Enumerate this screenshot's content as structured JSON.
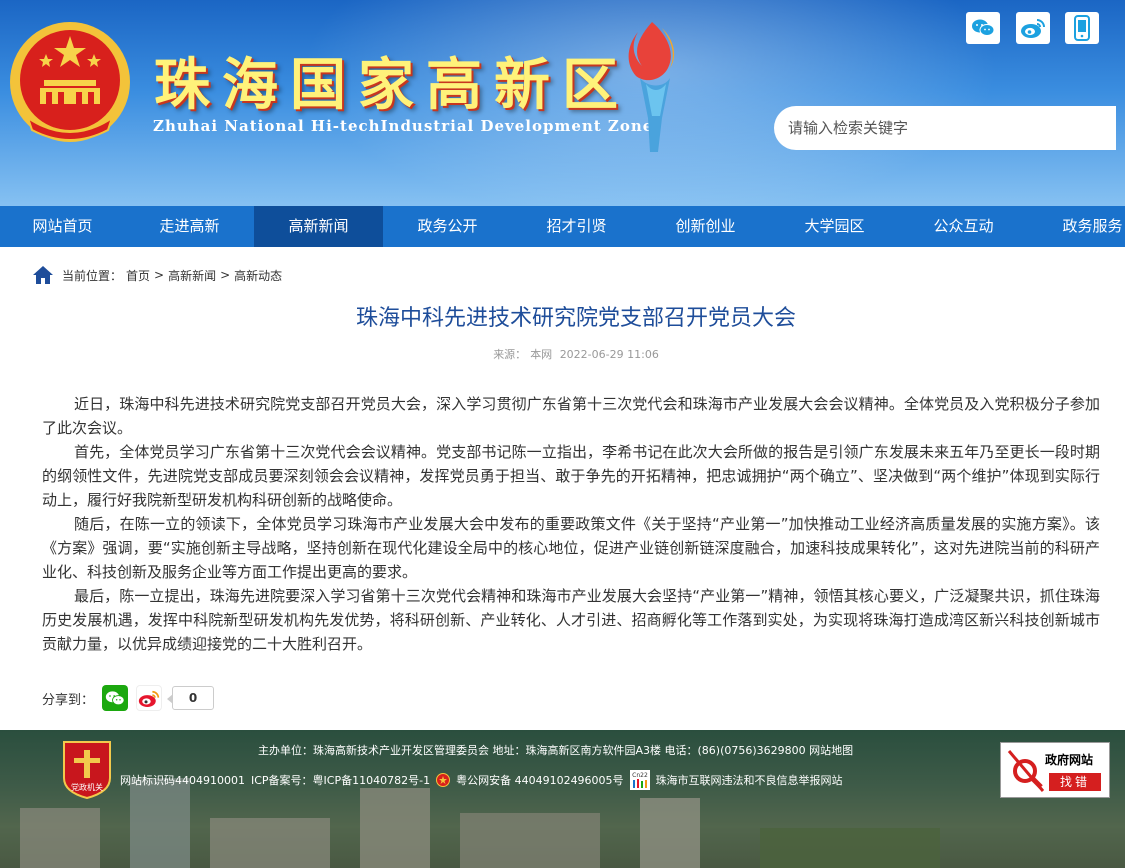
{
  "header": {
    "title": "珠海国家高新区",
    "subtitle": "Zhuhai National Hi-techIndustrial Development Zone",
    "search_placeholder": "请输入检索关键字"
  },
  "nav": {
    "items": [
      "网站首页",
      "走进高新",
      "高新新闻",
      "政务公开",
      "招才引贤",
      "创新创业",
      "大学园区",
      "公众互动",
      "政务服务"
    ],
    "active_index": 2
  },
  "breadcrumb": {
    "label": "当前位置：",
    "items": [
      "首页",
      "高新新闻",
      "高新动态"
    ],
    "separator": ">"
  },
  "article": {
    "title": "珠海中科先进技术研究院党支部召开党员大会",
    "source_label": "来源：",
    "source": "本网",
    "date": "2022-06-29 11:06",
    "paragraphs": [
      "近日，珠海中科先进技术研究院党支部召开党员大会，深入学习贯彻广东省第十三次党代会和珠海市产业发展大会会议精神。全体党员及入党积极分子参加了此次会议。",
      "首先，全体党员学习广东省第十三次党代会会议精神。党支部书记陈一立指出，李希书记在此次大会所做的报告是引领广东发展未来五年乃至更长一段时期的纲领性文件，先进院党支部成员要深刻领会会议精神，发挥党员勇于担当、敢于争先的开拓精神，把忠诚拥护“两个确立”、坚决做到“两个维护”体现到实际行动上，履行好我院新型研发机构科研创新的战略使命。",
      "随后，在陈一立的领读下，全体党员学习珠海市产业发展大会中发布的重要政策文件《关于坚持“产业第一”加快推动工业经济高质量发展的实施方案》。该《方案》强调，要“实施创新主导战略，坚持创新在现代化建设全局中的核心地位，促进产业链创新链深度融合，加速科技成果转化”，这对先进院当前的科研产业化、科技创新及服务企业等方面工作提出更高的要求。",
      "最后，陈一立提出，珠海先进院要深入学习省第十三次党代会精神和珠海市产业发展大会坚持“产业第一”精神，领悟其核心要义，广泛凝聚共识，抓住珠海历史发展机遇，发挥中科院新型研发机构先发优势，将科研创新、产业转化、人才引进、招商孵化等工作落到实处，为实现将珠海打造成湾区新兴科技创新城市贡献力量，以优异成绩迎接党的二十大胜利召开。"
    ]
  },
  "share": {
    "label": "分享到：",
    "count": "0"
  },
  "footer": {
    "line1": "主办单位：珠海高新技术产业开发区管理委员会 地址：珠海高新区南方软件园A3楼 电话：(86)(0756)3629800 网站地图",
    "site_id": "网站标识码4404910001",
    "icp": "ICP备案号：粤ICP备11040782号-1",
    "police": "粤公网安备 44049102496005号",
    "report": "珠海市互联网违法和不良信息举报网站",
    "badge_text": "党政机关",
    "cn22": "Cn22",
    "gov_error_title": "政府网站",
    "gov_error_action": "找错"
  },
  "colors": {
    "nav_bg": "#1a72cc",
    "nav_active": "#0e4e9a",
    "title_blue": "#1e4d9a",
    "wechat_green": "#1ca80f",
    "weibo_red": "#e6162d"
  }
}
